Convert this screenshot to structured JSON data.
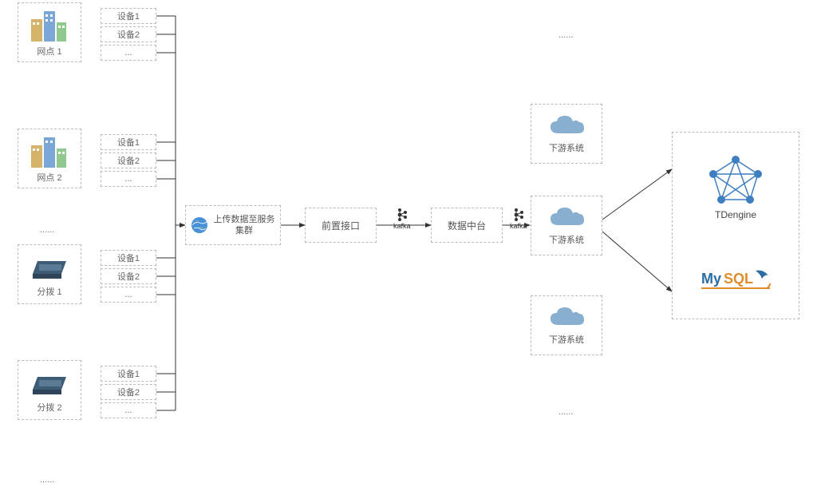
{
  "sites": [
    {
      "label": "网点 1",
      "devices": [
        "设备1",
        "设备2",
        "..."
      ]
    },
    {
      "label": "网点 2",
      "devices": [
        "设备1",
        "设备2",
        "..."
      ]
    },
    {
      "label": "分拨 1",
      "devices": [
        "设备1",
        "设备2",
        "..."
      ]
    },
    {
      "label": "分拨 2",
      "devices": [
        "设备1",
        "设备2",
        "..."
      ]
    }
  ],
  "left_ellipsis_top": "......",
  "left_ellipsis_bottom": "......",
  "cluster_label": "上传数据至服务集群",
  "stage1": "前置接口",
  "kafka1": "kafka",
  "stage2": "数据中台",
  "kafka2": "kafka",
  "downstream_label": "下游系统",
  "mid_ellipsis_top": "......",
  "mid_ellipsis_bottom": "......",
  "dest1_label": "TDengine",
  "dest2_label": "MySQL"
}
